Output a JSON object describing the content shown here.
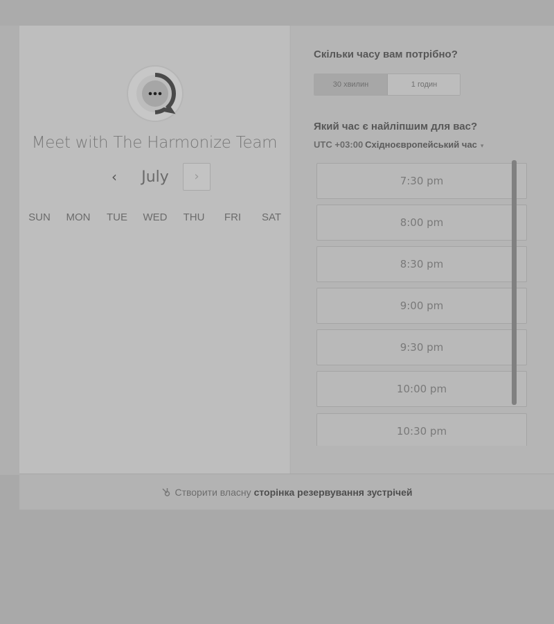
{
  "profile": {
    "meeting_title": "Meet with The Harmonize Team",
    "avatar_icon": "chat-bubble-icon"
  },
  "calendar": {
    "month": "July",
    "prev_icon": "‹",
    "next_icon": "›",
    "weekdays": [
      "SUN",
      "MON",
      "TUE",
      "WED",
      "THU",
      "FRI",
      "SAT"
    ]
  },
  "duration": {
    "question": "Скільки часу вам потрібно?",
    "options": [
      {
        "label": "30 хвилин",
        "selected": true
      },
      {
        "label": "1 годин",
        "selected": false
      }
    ]
  },
  "time": {
    "question": "Який час є найліпшим для вас?",
    "timezone_offset": "UTC +03:00",
    "timezone_name": "Східноєвропейський час",
    "caret": "▾",
    "slots": [
      "7:30 pm",
      "8:00 pm",
      "8:30 pm",
      "9:00 pm",
      "9:30 pm",
      "10:00 pm",
      "10:30 pm"
    ]
  },
  "footer": {
    "prefix": "Створити власну",
    "link": "сторінка резервування зустрічей"
  },
  "colors": {
    "overlay_bg": "#a9a9a9",
    "left_panel": "#bebebe",
    "right_panel": "#b5b5b5"
  }
}
